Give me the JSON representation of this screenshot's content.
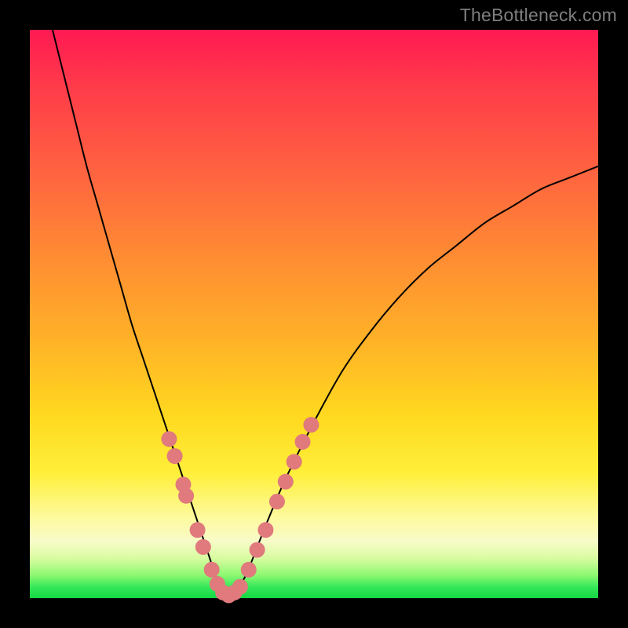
{
  "watermark": "TheBottleneck.com",
  "chart_data": {
    "type": "line",
    "title": "",
    "xlabel": "",
    "ylabel": "",
    "xlim": [
      0,
      100
    ],
    "ylim": [
      0,
      100
    ],
    "series": [
      {
        "name": "bottleneck-curve",
        "x": [
          4,
          6,
          8,
          10,
          12,
          14,
          16,
          18,
          20,
          22,
          24,
          26,
          28,
          30,
          32,
          33,
          34,
          35,
          36,
          38,
          40,
          42,
          45,
          50,
          55,
          60,
          65,
          70,
          75,
          80,
          85,
          90,
          95,
          100
        ],
        "y": [
          100,
          92,
          84,
          76,
          69,
          62,
          55,
          48,
          42,
          36,
          30,
          24,
          18,
          12,
          6,
          3,
          1,
          0,
          1,
          4,
          9,
          14,
          21,
          31,
          40,
          47,
          53,
          58,
          62,
          66,
          69,
          72,
          74,
          76
        ]
      }
    ],
    "markers": {
      "name": "highlight-dots",
      "color": "#e07a7d",
      "points": [
        {
          "x": 24.5,
          "y": 28
        },
        {
          "x": 25.5,
          "y": 25
        },
        {
          "x": 27.0,
          "y": 20
        },
        {
          "x": 27.5,
          "y": 18
        },
        {
          "x": 29.5,
          "y": 12
        },
        {
          "x": 30.5,
          "y": 9
        },
        {
          "x": 32.0,
          "y": 5
        },
        {
          "x": 33.0,
          "y": 2.5
        },
        {
          "x": 34.0,
          "y": 1
        },
        {
          "x": 35.0,
          "y": 0.5
        },
        {
          "x": 36.0,
          "y": 1
        },
        {
          "x": 37.0,
          "y": 2
        },
        {
          "x": 38.5,
          "y": 5
        },
        {
          "x": 40.0,
          "y": 8.5
        },
        {
          "x": 41.5,
          "y": 12
        },
        {
          "x": 43.5,
          "y": 17
        },
        {
          "x": 45.0,
          "y": 20.5
        },
        {
          "x": 46.5,
          "y": 24
        },
        {
          "x": 48.0,
          "y": 27.5
        },
        {
          "x": 49.5,
          "y": 30.5
        }
      ]
    }
  }
}
